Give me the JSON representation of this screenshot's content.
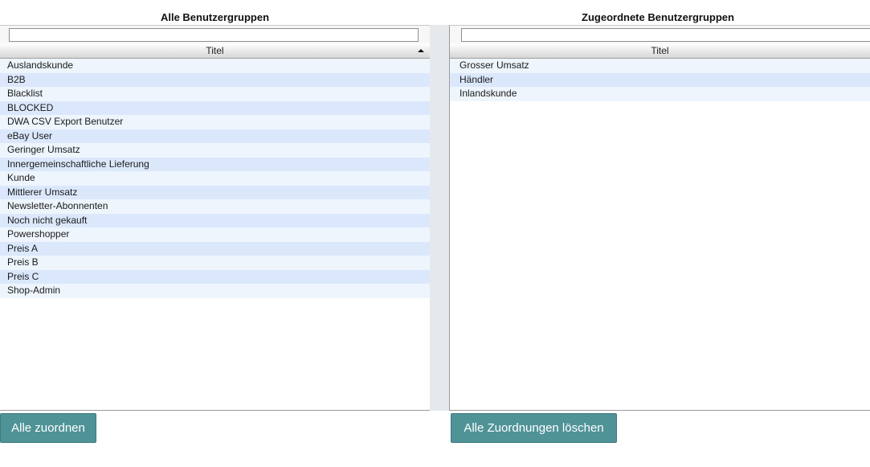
{
  "left_panel": {
    "title": "Alle Benutzergruppen",
    "filter_value": "",
    "column_header": "Titel",
    "rows": [
      "Auslandskunde",
      "B2B",
      "Blacklist",
      "BLOCKED",
      "DWA CSV Export Benutzer",
      "eBay User",
      "Geringer Umsatz",
      "Innergemeinschaftliche Lieferung",
      "Kunde",
      "Mittlerer Umsatz",
      "Newsletter-Abonnenten",
      "Noch nicht gekauft",
      "Powershopper",
      "Preis A",
      "Preis B",
      "Preis C",
      "Shop-Admin"
    ]
  },
  "right_panel": {
    "title": "Zugeordnete Benutzergruppen",
    "filter_value": "",
    "column_header": "Titel",
    "rows": [
      "Grosser Umsatz",
      "Händler",
      "Inlandskunde"
    ]
  },
  "buttons": {
    "assign_all": "Alle zuordnen",
    "remove_all": "Alle Zuordnungen löschen"
  },
  "colors": {
    "button_bg": "#4f9397",
    "row_odd": "#eef5fd",
    "row_even": "#dbe8fc"
  },
  "icons": {
    "sort": "sort-ascending-icon"
  }
}
